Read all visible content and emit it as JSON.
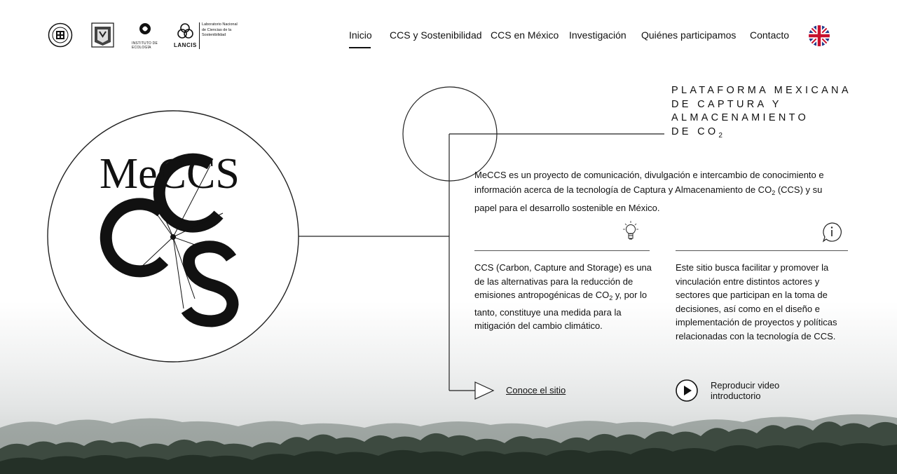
{
  "brand": {
    "logos": [
      {
        "name": "university-seal-logo"
      },
      {
        "name": "unam-seal-logo"
      },
      {
        "name": "instituto-ecologia-logo",
        "text": "INSTITUTO DE ECOLOGÍA"
      },
      {
        "name": "lancis-logo",
        "text": "LANCIS",
        "subtitle": "Laboratorio Nacional de Ciencias de la Sostenibilidad"
      }
    ]
  },
  "nav": {
    "items": [
      "Inicio",
      "CCS y Sostenibilidad",
      "CCS en México",
      "Investigación",
      "Quiénes participamos",
      "Contacto"
    ],
    "active": "Inicio",
    "language_icon": "uk-flag-icon"
  },
  "hero": {
    "logo_text": "MeCCS",
    "title_lines": [
      "PLATAFORMA MEXICANA",
      "DE CAPTURA Y",
      "ALMACENAMIENTO",
      "DE CO"
    ],
    "title_sub": "2",
    "intro_a": "MeCCS es un proyecto de comunicación, divulgación e intercambio de conocimiento e información acerca de la tecnología de Captura y Almacenamiento de CO",
    "intro_sub": "2",
    "intro_b": " (CCS) y su papel para el desarrollo sostenible en México.",
    "col_left_a": "CCS (Carbon, Capture and Storage) es una de las alternativas para la reducción de emisiones antropogénicas de CO",
    "col_left_sub": "2",
    "col_left_b": " y, por lo tanto, constituye una medida para la mitigación del cambio climático.",
    "col_right": "Este sitio busca facilitar y promover la vinculación entre distintos actores y sectores que participan en la toma de decisiones, así como en el diseño e implementación de proyectos y políticas relacionadas con la tecnología de CCS.",
    "cta": "Conoce el sitio",
    "video": "Reproducir video introductorio",
    "icons": [
      "lightbulb-icon",
      "info-icon",
      "play-icon",
      "arrow-right-icon"
    ]
  },
  "colors": {
    "text": "#111111",
    "line": "#222222",
    "forest": "#2f3a2f"
  }
}
